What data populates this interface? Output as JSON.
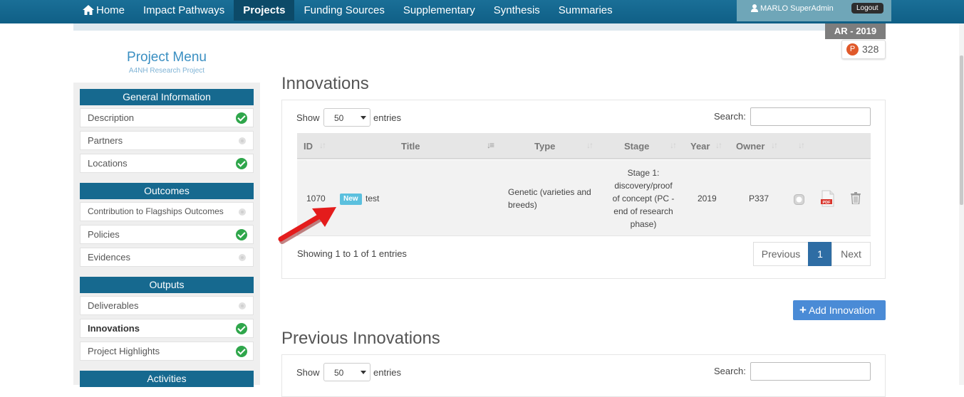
{
  "nav": {
    "items": [
      {
        "label": "Home",
        "active": false,
        "icon": "home-icon"
      },
      {
        "label": "Impact Pathways",
        "active": false
      },
      {
        "label": "Projects",
        "active": true
      },
      {
        "label": "Funding Sources",
        "active": false
      },
      {
        "label": "Supplementary",
        "active": false
      },
      {
        "label": "Synthesis",
        "active": false
      },
      {
        "label": "Summaries",
        "active": false
      }
    ],
    "user": "MARLO SuperAdmin",
    "logout": "Logout"
  },
  "phase": "AR - 2019",
  "points": {
    "badge": "P",
    "value": "328"
  },
  "sidebar": {
    "title": "Project Menu",
    "subtitle": "A4NH Research Project",
    "sections": [
      {
        "header": "General Information",
        "items": [
          {
            "label": "Description",
            "status": "complete"
          },
          {
            "label": "Partners",
            "status": "pending"
          },
          {
            "label": "Locations",
            "status": "complete"
          }
        ]
      },
      {
        "header": "Outcomes",
        "items": [
          {
            "label": "Contribution to Flagships Outcomes",
            "status": "pending"
          },
          {
            "label": "Policies",
            "status": "complete"
          },
          {
            "label": "Evidences",
            "status": "pending"
          }
        ]
      },
      {
        "header": "Outputs",
        "items": [
          {
            "label": "Deliverables",
            "status": "pending"
          },
          {
            "label": "Innovations",
            "status": "complete",
            "current": true
          },
          {
            "label": "Project Highlights",
            "status": "complete"
          }
        ]
      },
      {
        "header": "Activities",
        "items": []
      }
    ]
  },
  "innovations": {
    "title": "Innovations",
    "show_label": "Show",
    "page_size": "50",
    "entries_label": "entries",
    "search_label": "Search:",
    "columns": [
      "ID",
      "Title",
      "Type",
      "Stage",
      "Year",
      "Owner"
    ],
    "row": {
      "id": "1070",
      "badge": "New",
      "title": "test",
      "type_line1": "Genetic (varieties and",
      "type_line2": "breeds)",
      "stage_line1": "Stage 1:",
      "stage_line2": "discovery/proof",
      "stage_line3": "of concept (PC -",
      "stage_line4": "end of research",
      "stage_line5": "phase)",
      "year": "2019",
      "owner": "P337",
      "pdf_label": "PDF"
    },
    "info": "Showing 1 to 1 of 1 entries",
    "pager": {
      "previous": "Previous",
      "page": "1",
      "next": "Next"
    }
  },
  "add_button": "Add Innovation",
  "previous": {
    "title": "Previous Innovations",
    "show_label": "Show",
    "page_size": "50",
    "entries_label": "entries",
    "search_label": "Search:"
  },
  "colors": {
    "nav": "#1a6f97",
    "section_header": "#16698f",
    "accent": "#4a8bd6",
    "complete": "#2fa64b",
    "arrow": "#e41c1c"
  }
}
